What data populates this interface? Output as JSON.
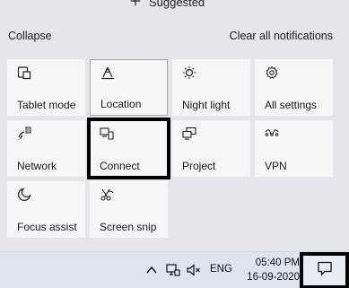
{
  "header": {
    "suggested_label": "Suggested",
    "collapse_label": "Collapse",
    "clear_all_label": "Clear all notifications"
  },
  "tiles": [
    {
      "label": "Tablet mode",
      "icon": "tablet-mode-icon"
    },
    {
      "label": "Location",
      "icon": "location-icon"
    },
    {
      "label": "Night light",
      "icon": "night-light-icon"
    },
    {
      "label": "All settings",
      "icon": "settings-gear-icon"
    },
    {
      "label": "Network",
      "icon": "network-icon"
    },
    {
      "label": "Connect",
      "icon": "connect-icon"
    },
    {
      "label": "Project",
      "icon": "project-icon"
    },
    {
      "label": "VPN",
      "icon": "vpn-icon"
    },
    {
      "label": "Focus assist",
      "icon": "focus-assist-moon-icon"
    },
    {
      "label": "Screen snip",
      "icon": "screen-snip-icon"
    }
  ],
  "taskbar": {
    "language": "ENG",
    "time": "05:40 PM",
    "date": "16-09-2020"
  },
  "colors": {
    "panel_background": "#e4e6ec",
    "tile_background": "#f5f6f8",
    "taskbar_background": "#dde3ef",
    "highlight_border": "#000000"
  }
}
